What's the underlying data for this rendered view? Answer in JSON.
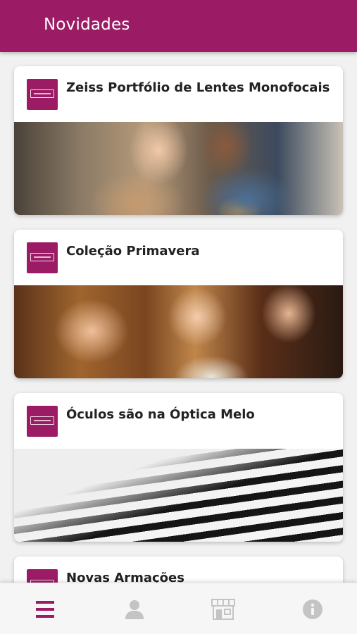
{
  "header": {
    "title": "Novidades"
  },
  "feed": {
    "cards": [
      {
        "title": "Zeiss Portfólio de Lentes Monofocais"
      },
      {
        "title": "Coleção Primavera"
      },
      {
        "title": "Óculos são na Óptica Melo"
      },
      {
        "title": "Novas Armações"
      }
    ]
  },
  "bottom_nav": {
    "items": [
      {
        "icon": "menu-icon",
        "active": true
      },
      {
        "icon": "user-icon",
        "active": false
      },
      {
        "icon": "store-icon",
        "active": false
      },
      {
        "icon": "info-icon",
        "active": false
      }
    ]
  },
  "colors": {
    "brand": "#9b1c64",
    "background": "#f1f1f1",
    "nav_inactive": "#c4c4c4"
  }
}
